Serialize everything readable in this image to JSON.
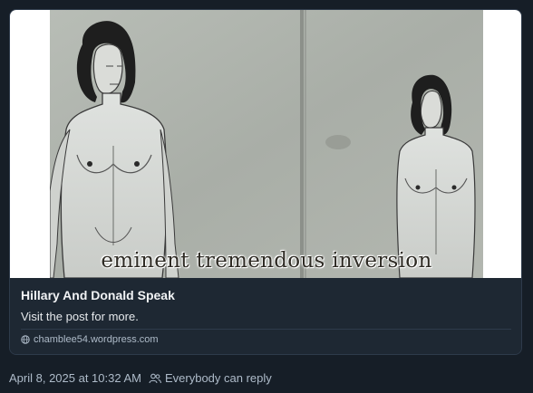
{
  "link_card": {
    "image_caption": "eminent tremendous inversion",
    "title": "Hillary And Donald Speak",
    "description": "Visit the post for more.",
    "domain": "chamblee54.wordpress.com",
    "domain_icon": "globe-icon"
  },
  "post_meta": {
    "timestamp": "April 8, 2025 at 10:32 AM",
    "reply_setting": "Everybody can reply",
    "reply_icon": "people-icon"
  },
  "colors": {
    "background": "#161e27",
    "card_border": "#2e3b4b",
    "text_primary": "#f1f3f5",
    "text_secondary": "#aebbc9"
  }
}
